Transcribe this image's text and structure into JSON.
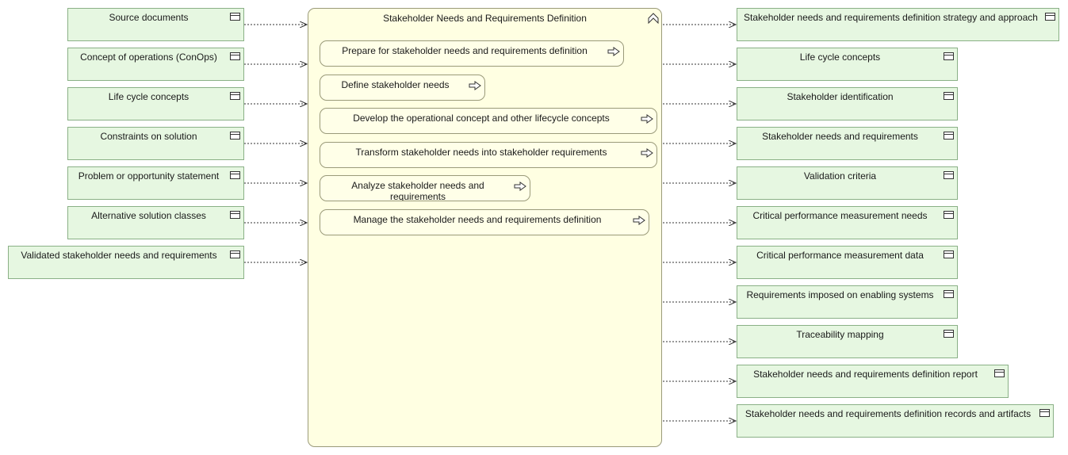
{
  "process": {
    "title": "Stakeholder Needs and Requirements Definition",
    "steps": [
      "Prepare for stakeholder needs and requirements definition",
      "Define stakeholder needs",
      "Develop the operational concept and other lifecycle concepts",
      "Transform stakeholder needs into stakeholder requirements",
      "Analyze stakeholder needs and requirements",
      "Manage the stakeholder needs and requirements definition"
    ]
  },
  "inputs": [
    "Source documents",
    "Concept of operations (ConOps)",
    "Life cycle concepts",
    "Constraints on solution",
    "Problem or opportunity statement",
    "Alternative solution classes",
    "Validated stakeholder needs and requirements"
  ],
  "outputs": [
    "Stakeholder needs and requirements definition strategy and approach",
    "Life cycle concepts",
    "Stakeholder identification",
    "Stakeholder needs and requirements",
    "Validation criteria",
    "Critical performance measurement needs",
    "Critical performance measurement data",
    "Requirements imposed on enabling systems",
    "Traceability mapping",
    "Stakeholder needs and requirements definition report",
    "Stakeholder needs and requirements definition records and artifacts"
  ],
  "colors": {
    "object_fill": "#e6f7e1",
    "process_fill": "#ffffe2",
    "connector": "#333333"
  }
}
